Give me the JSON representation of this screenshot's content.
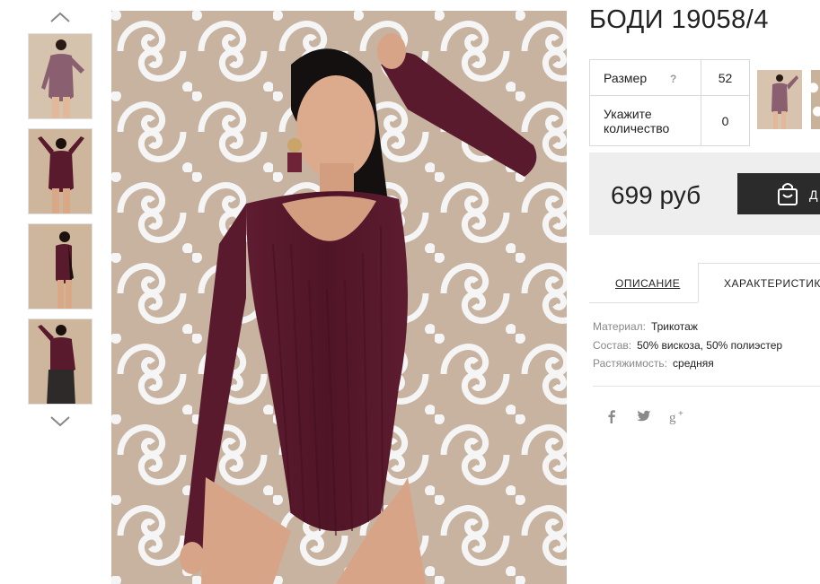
{
  "product": {
    "title": "БОДИ 19058/4",
    "size_label": "Размер",
    "size_help": "?",
    "size_value": "52",
    "qty_label_line1": "Укажите",
    "qty_label_line2": "количество",
    "qty_value": "0",
    "price": "699 руб",
    "cart_button_label": "Д"
  },
  "gallery": {
    "up_arrow_icon": "chevron-up-icon",
    "down_arrow_icon": "chevron-down-icon",
    "thumbnail_count": 4
  },
  "tabs": [
    {
      "label": "ОПИСАНИЕ",
      "active": false
    },
    {
      "label": "ХАРАКТЕРИСТИКИ",
      "active": true
    }
  ],
  "characteristics": [
    {
      "key": "Материал:",
      "value": "Трикотаж"
    },
    {
      "key": "Состав:",
      "value": "50% вискоза, 50% полиэстер"
    },
    {
      "key": "Растяжимость:",
      "value": "средняя"
    }
  ],
  "social": [
    "facebook-icon",
    "twitter-icon",
    "google-plus-icon"
  ],
  "colors": {
    "garment": "#5a1a2e",
    "button_dark": "#2b2b2b",
    "price_bg": "#eeeeee"
  }
}
